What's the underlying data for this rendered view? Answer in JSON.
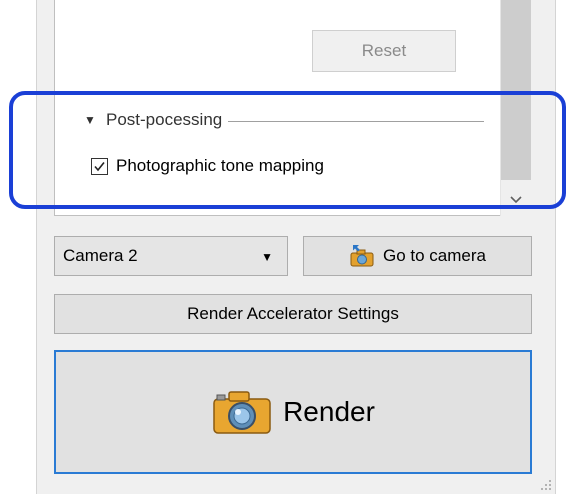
{
  "settings": {
    "reset_label": "Reset",
    "post_processing": {
      "group_label": "Post-pocessing",
      "tone_mapping_label": "Photographic tone mapping",
      "tone_mapping_checked": true
    }
  },
  "camera": {
    "selected": "Camera 2",
    "go_to_label": "Go to camera"
  },
  "accelerator_label": "Render Accelerator Settings",
  "render_label": "Render",
  "colors": {
    "highlight": "#1a3fd6",
    "render_border": "#2a7bd4"
  }
}
